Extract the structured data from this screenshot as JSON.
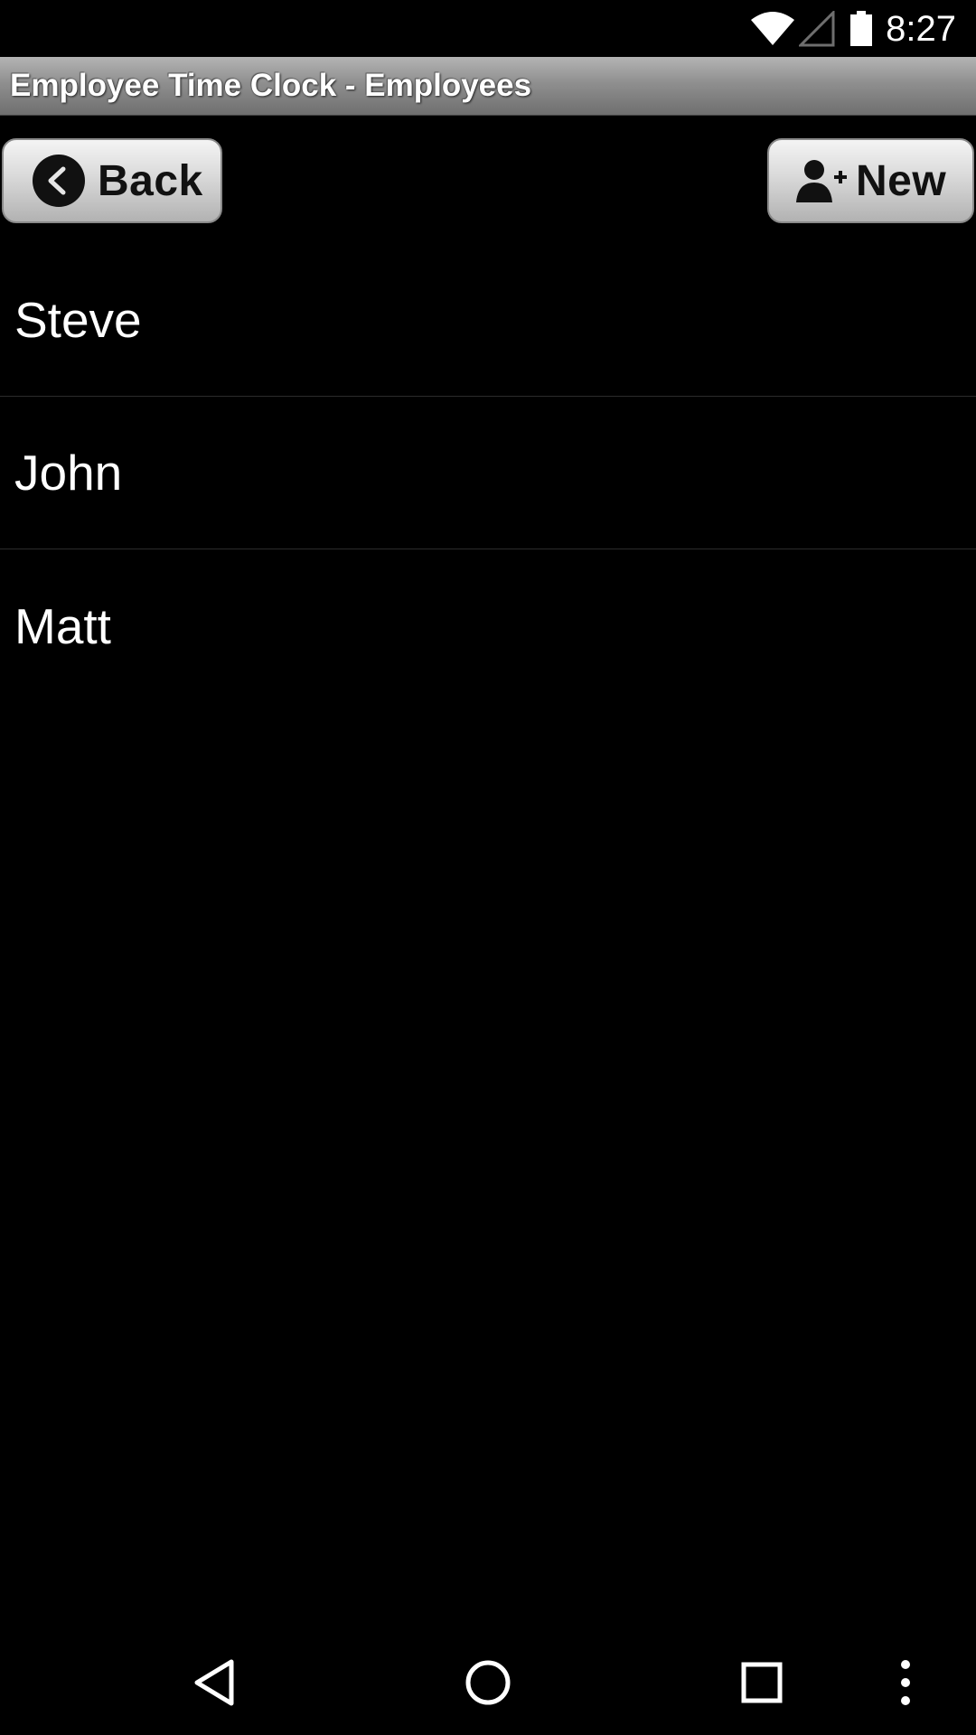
{
  "status_bar": {
    "time": "8:27",
    "icons": [
      "wifi-icon",
      "cell-signal-icon",
      "battery-icon"
    ]
  },
  "title_bar": {
    "title": "Employee Time Clock - Employees"
  },
  "toolbar": {
    "back_label": "Back",
    "back_icon": "chevron-left-circle-icon",
    "new_label": "New",
    "new_icon": "add-user-icon"
  },
  "employees": [
    {
      "name": "Steve"
    },
    {
      "name": "John"
    },
    {
      "name": "Matt"
    }
  ],
  "nav_bar": {
    "icons": [
      "back-triangle-icon",
      "home-circle-icon",
      "recents-square-icon",
      "overflow-menu-icon"
    ]
  },
  "colors": {
    "background": "#000000",
    "title_bar_top": "#b4b4b4",
    "title_bar_bottom": "#6f6f6f",
    "button_top": "#f4f4f4",
    "button_bottom": "#b2b2b2",
    "text": "#ffffff"
  }
}
